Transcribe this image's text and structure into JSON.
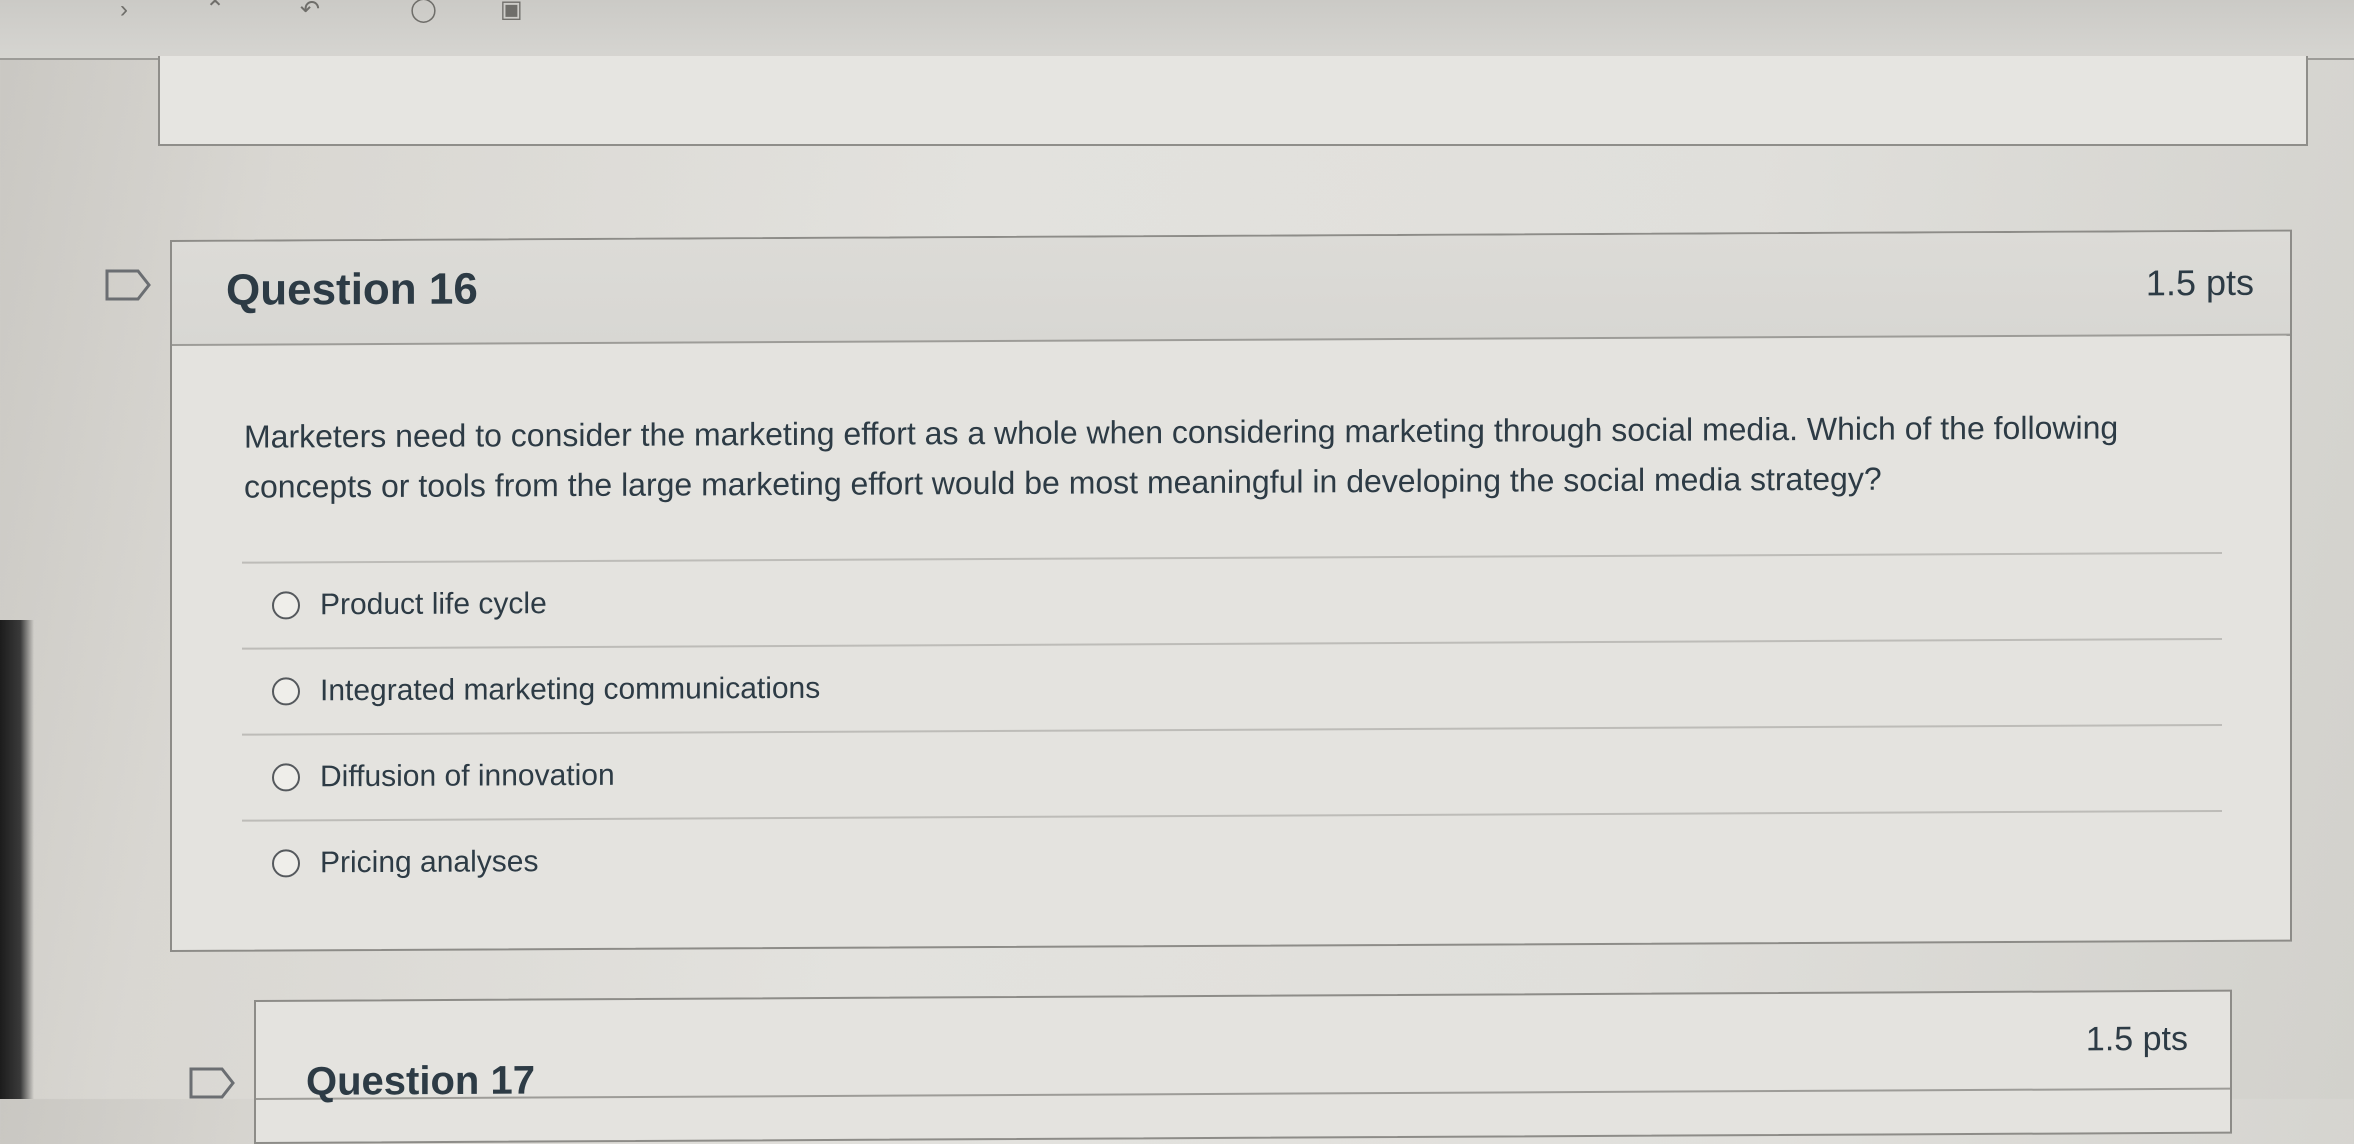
{
  "current_question": {
    "title": "Question 16",
    "points": "1.5 pts",
    "text": "Marketers need to consider the marketing effort as a whole when considering marketing through social media. Which of the following concepts or tools from the large marketing effort would be most meaningful in developing the social media strategy?",
    "answers": [
      {
        "label": "Product life cycle",
        "selected": false
      },
      {
        "label": "Integrated marketing communications",
        "selected": false
      },
      {
        "label": "Diffusion of innovation",
        "selected": false
      },
      {
        "label": "Pricing analyses",
        "selected": false
      }
    ],
    "flag_icon": "flag-question-icon"
  },
  "next_question": {
    "title": "Question 17",
    "points": "1.5 pts",
    "flag_icon": "flag-question-icon"
  },
  "colors": {
    "text": "#2d3b45",
    "card_background": "#e4e3df",
    "border": "#8d8c88"
  }
}
